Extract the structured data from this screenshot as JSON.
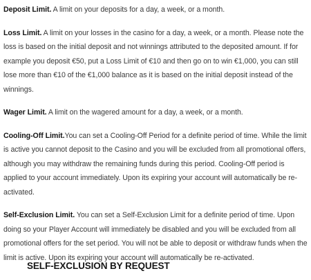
{
  "paragraphs": [
    {
      "term": "Deposit Limit.",
      "text": " A limit on your deposits for a day, a week, or a month."
    },
    {
      "term": "Loss Limit.",
      "text": " A limit on your losses in the casino for a day, a week, or a month. Please note the loss is based on the initial deposit and not winnings attributed to the deposited amount. If for example you deposit €50, put a Loss Limit of €10 and then go on to win €1,000, you can still lose more than €10 of the €1,000 balance as it is based on the initial deposit instead of the winnings."
    },
    {
      "term": "Wager Limit.",
      "text": " A limit on the wagered amount for a day, a week, or a month."
    },
    {
      "term": "Cooling-Off Limit.",
      "text": "You can set a Cooling-Off Period for a definite period of time. While the limit is active you cannot deposit to the Casino and you will be excluded from all promotional offers, although you may withdraw the remaining funds during this period. Cooling-Off period is applied to your account immediately. Upon its expiring your account will automatically be re-activated."
    },
    {
      "term": "Self-Exclusion Limit.",
      "text": " You can set a Self-Exclusion Limit for a definite period of time. Upon doing so your Player Account will immediately be disabled and you will be excluded from all promotional offers for the set period. You will not be able to deposit or withdraw funds when the limit is active. Upon its expiring your account will automatically be re-activated."
    }
  ],
  "section_heading": "SELF-EXCLUSION BY REQUEST"
}
